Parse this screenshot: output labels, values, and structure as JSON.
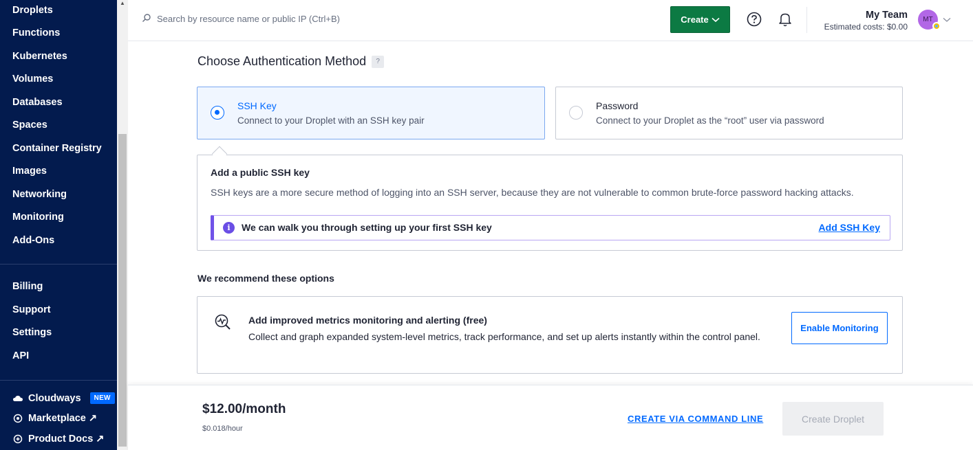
{
  "sidebar": {
    "items": [
      {
        "label": "Droplets"
      },
      {
        "label": "Functions"
      },
      {
        "label": "Kubernetes"
      },
      {
        "label": "Volumes"
      },
      {
        "label": "Databases"
      },
      {
        "label": "Spaces"
      },
      {
        "label": "Container Registry"
      },
      {
        "label": "Images"
      },
      {
        "label": "Networking"
      },
      {
        "label": "Monitoring"
      },
      {
        "label": "Add-Ons"
      }
    ],
    "account_items": [
      {
        "label": "Billing"
      },
      {
        "label": "Support"
      },
      {
        "label": "Settings"
      },
      {
        "label": "API"
      }
    ],
    "external": {
      "cloudways": "Cloudways",
      "cloudways_badge": "NEW",
      "marketplace": "Marketplace ↗",
      "product_docs": "Product Docs ↗"
    }
  },
  "topbar": {
    "search_placeholder": "Search by resource name or public IP (Ctrl+B)",
    "create_label": "Create",
    "team_name": "My Team",
    "estimated_costs": "Estimated costs: $0.00",
    "avatar_initials": "MT"
  },
  "auth": {
    "heading": "Choose Authentication Method",
    "help_glyph": "?",
    "options": [
      {
        "title": "SSH Key",
        "desc": "Connect to your Droplet with an SSH key pair",
        "selected": true
      },
      {
        "title": "Password",
        "desc": "Connect to your Droplet as the “root” user via password",
        "selected": false
      }
    ],
    "ssh_panel": {
      "title": "Add a public SSH key",
      "desc": "SSH keys are a more secure method of logging into an SSH server, because they are not vulnerable to common brute-force password hacking attacks.",
      "info_text": "We can walk you through setting up your first SSH key",
      "info_link": "Add SSH Key"
    }
  },
  "recommend": {
    "heading": "We recommend these options",
    "monitoring": {
      "title": "Add improved metrics monitoring and alerting (free)",
      "desc": "Collect and graph expanded system-level metrics, track performance, and set up alerts instantly within the control panel.",
      "button": "Enable Monitoring"
    }
  },
  "footer": {
    "price": "$12.00/month",
    "price_hour": "$0.018/hour",
    "cmd_link": "CREATE VIA COMMAND LINE",
    "create_button": "Create Droplet"
  },
  "colors": {
    "sidebar_bg": "#031b4e",
    "accent_blue": "#0069ff",
    "create_green": "#0c7a43",
    "info_purple": "#7052e8"
  }
}
